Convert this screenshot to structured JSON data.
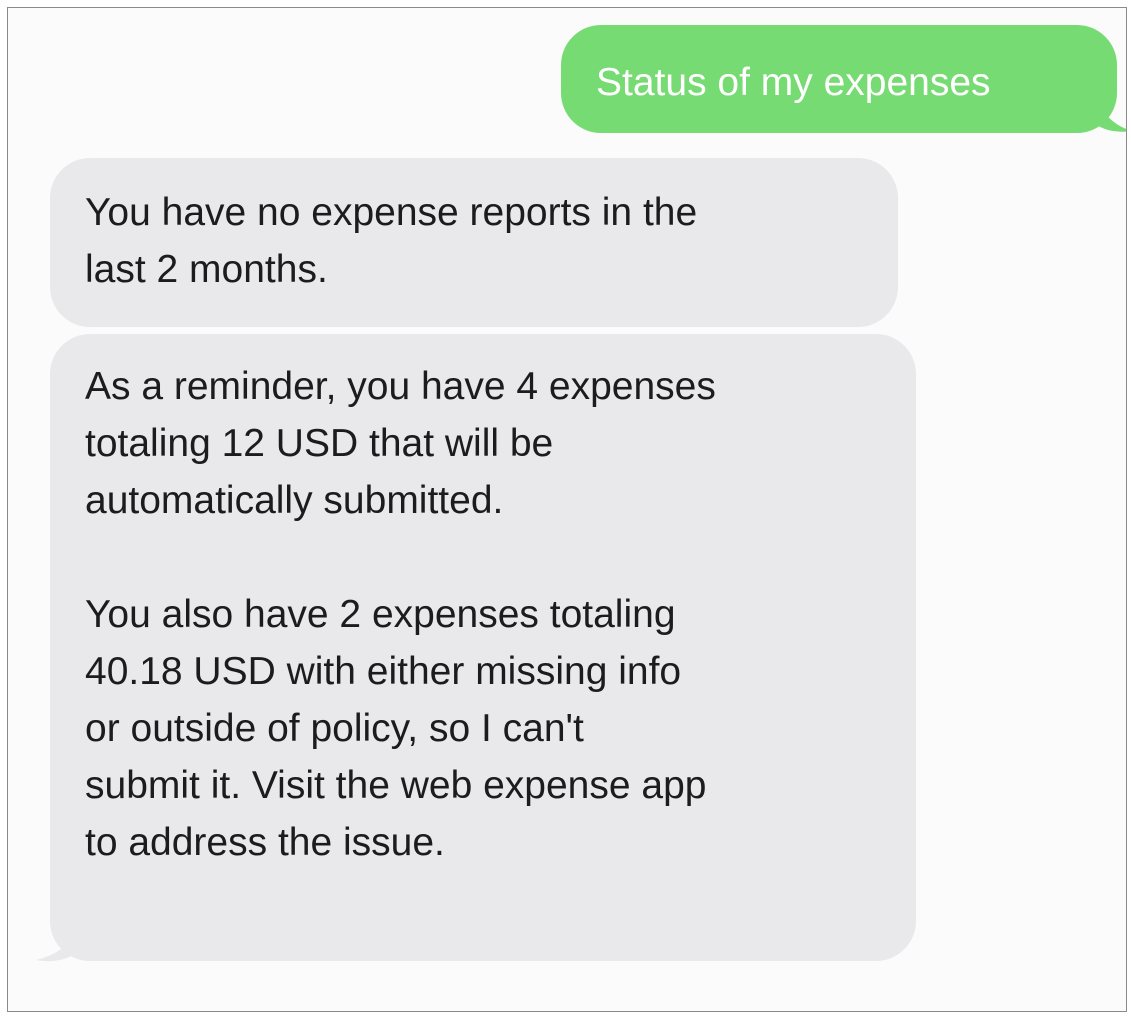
{
  "conversation": {
    "messages": [
      {
        "sender": "user",
        "text": "Status of my expenses"
      },
      {
        "sender": "bot",
        "text": "You have no expense reports in the\nlast 2 months."
      },
      {
        "sender": "bot",
        "paragraphs": [
          "As a reminder, you have 4 expenses\ntotaling 12 USD that will be\nautomatically submitted.",
          "You also have 2 expenses totaling\n40.18 USD with either missing info\nor outside of policy, so I can't\nsubmit it. Visit the web expense app\nto address the issue."
        ]
      }
    ]
  },
  "colors": {
    "sent_bubble": "#76db72",
    "received_bubble": "#e9e9eb",
    "background": "#fbfbfb"
  }
}
